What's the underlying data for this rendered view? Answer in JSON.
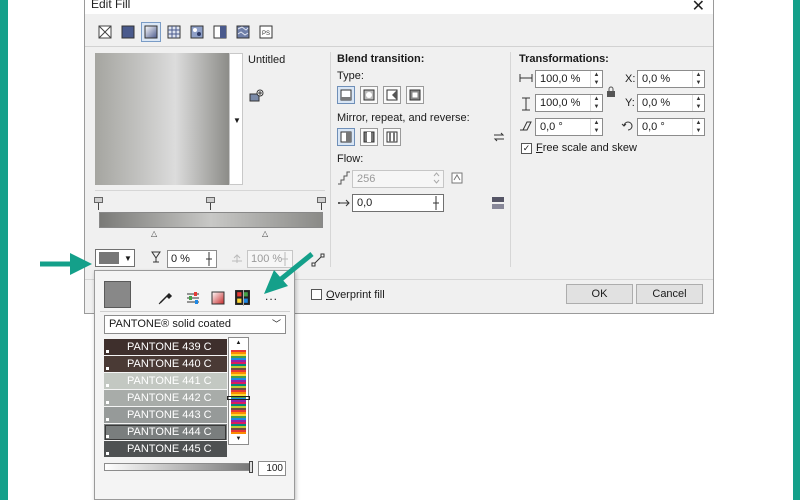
{
  "dialog": {
    "title": "Edit Fill",
    "close_glyph": "✕"
  },
  "toolbar": [
    "no-fill",
    "uniform-fill",
    "fountain-fill",
    "vector-pattern-fill",
    "bitmap-pattern-fill",
    "two-color-pattern-fill",
    "texture-fill",
    "postscript-fill"
  ],
  "preview": {
    "name": "Untitled"
  },
  "gradient": {
    "node_color": "#777777",
    "opacity": "0 %",
    "node_position": "100 %"
  },
  "blend": {
    "title": "Blend transition:",
    "type_label": "Type:",
    "mirror_label": "Mirror, repeat, and reverse:",
    "flow_label": "Flow:",
    "steps": "256",
    "acceleration": "0,0"
  },
  "transform": {
    "title": "Transformations:",
    "width": "100,0 %",
    "height": "100,0 %",
    "skew": "0,0 °",
    "rotate": "0,0 °",
    "x_label": "X:",
    "x": "0,0 %",
    "y_label": "Y:",
    "y": "0,0 %",
    "free_scale_prefix": "F",
    "free_scale_rest": "ree scale and skew",
    "free_scale_checked": "✓"
  },
  "footer": {
    "overprint_prefix": "O",
    "overprint_rest": "verprint fill",
    "ok": "OK",
    "cancel": "Cancel"
  },
  "popup": {
    "palette": "PANTONE® solid coated",
    "more_glyph": "...",
    "items": [
      {
        "name": "PANTONE 439 C",
        "color": "#3e2f2c"
      },
      {
        "name": "PANTONE 440 C",
        "color": "#4a3a35"
      },
      {
        "name": "PANTONE 441 C",
        "color": "#c3c8c2"
      },
      {
        "name": "PANTONE 442 C",
        "color": "#a8aca9"
      },
      {
        "name": "PANTONE 443 C",
        "color": "#969a99"
      },
      {
        "name": "PANTONE 444 C",
        "color": "#7a7e7e"
      },
      {
        "name": "PANTONE 445 C",
        "color": "#4e5152"
      }
    ],
    "selected_index": 5,
    "tint": "100"
  },
  "colors": {
    "accent_teal": "#14a08a",
    "dialog_bg": "#f0f0f0"
  }
}
